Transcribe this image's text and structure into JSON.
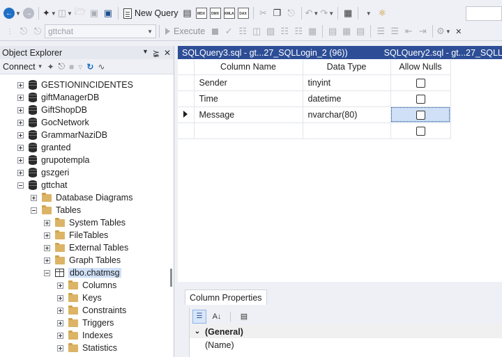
{
  "toolbar1": {
    "new_query_label": "New Query",
    "mini_docs": [
      "MDX",
      "DMX",
      "XMLA",
      "DAX"
    ]
  },
  "toolbar2": {
    "database_value": "gttchat",
    "execute_label": "Execute"
  },
  "object_explorer": {
    "title": "Object Explorer",
    "connect_label": "Connect",
    "tree": [
      {
        "label": "GESTIONINCIDENTES",
        "kind": "db",
        "level": 0,
        "expander": "plus"
      },
      {
        "label": "giftManagerDB",
        "kind": "db",
        "level": 0,
        "expander": "plus"
      },
      {
        "label": "GiftShopDB",
        "kind": "db",
        "level": 0,
        "expander": "plus"
      },
      {
        "label": "GocNetwork",
        "kind": "db",
        "level": 0,
        "expander": "plus"
      },
      {
        "label": "GrammarNaziDB",
        "kind": "db",
        "level": 0,
        "expander": "plus"
      },
      {
        "label": "granted",
        "kind": "db",
        "level": 0,
        "expander": "plus"
      },
      {
        "label": "grupotempla",
        "kind": "db",
        "level": 0,
        "expander": "plus"
      },
      {
        "label": "gszgeri",
        "kind": "db",
        "level": 0,
        "expander": "plus"
      },
      {
        "label": "gttchat",
        "kind": "db",
        "level": 0,
        "expander": "minus"
      },
      {
        "label": "Database Diagrams",
        "kind": "folder",
        "level": 1,
        "expander": "plus"
      },
      {
        "label": "Tables",
        "kind": "folder",
        "level": 1,
        "expander": "minus"
      },
      {
        "label": "System Tables",
        "kind": "folder",
        "level": 2,
        "expander": "plus"
      },
      {
        "label": "FileTables",
        "kind": "folder",
        "level": 2,
        "expander": "plus"
      },
      {
        "label": "External Tables",
        "kind": "folder",
        "level": 2,
        "expander": "plus"
      },
      {
        "label": "Graph Tables",
        "kind": "folder",
        "level": 2,
        "expander": "plus"
      },
      {
        "label": "dbo.chatmsg",
        "kind": "table",
        "level": 2,
        "expander": "minus",
        "selected": true
      },
      {
        "label": "Columns",
        "kind": "folder",
        "level": 3,
        "expander": "plus"
      },
      {
        "label": "Keys",
        "kind": "folder",
        "level": 3,
        "expander": "plus"
      },
      {
        "label": "Constraints",
        "kind": "folder",
        "level": 3,
        "expander": "plus"
      },
      {
        "label": "Triggers",
        "kind": "folder",
        "level": 3,
        "expander": "plus"
      },
      {
        "label": "Indexes",
        "kind": "folder",
        "level": 3,
        "expander": "plus"
      },
      {
        "label": "Statistics",
        "kind": "folder",
        "level": 3,
        "expander": "plus"
      }
    ]
  },
  "document_tabs": [
    {
      "label": "SQLQuery3.sql - gt...27_SQLLogin_2 (96))"
    },
    {
      "label": "SQLQuery2.sql - gt...27_SQLLogin_2 (7"
    }
  ],
  "designer": {
    "headers": [
      "Column Name",
      "Data Type",
      "Allow Nulls"
    ],
    "rows": [
      {
        "name": "Sender",
        "type": "tinyint",
        "allow_nulls": false,
        "current": false
      },
      {
        "name": "Time",
        "type": "datetime",
        "allow_nulls": false,
        "current": false
      },
      {
        "name": "Message",
        "type": "nvarchar(80)",
        "allow_nulls": false,
        "current": true
      },
      {
        "name": "",
        "type": "",
        "allow_nulls": false,
        "current": false
      }
    ]
  },
  "column_properties": {
    "tab_label": "Column Properties",
    "category": "(General)",
    "first_property": "(Name)"
  },
  "colors": {
    "accent": "#2d4e96",
    "selection": "#cfe0f7"
  }
}
